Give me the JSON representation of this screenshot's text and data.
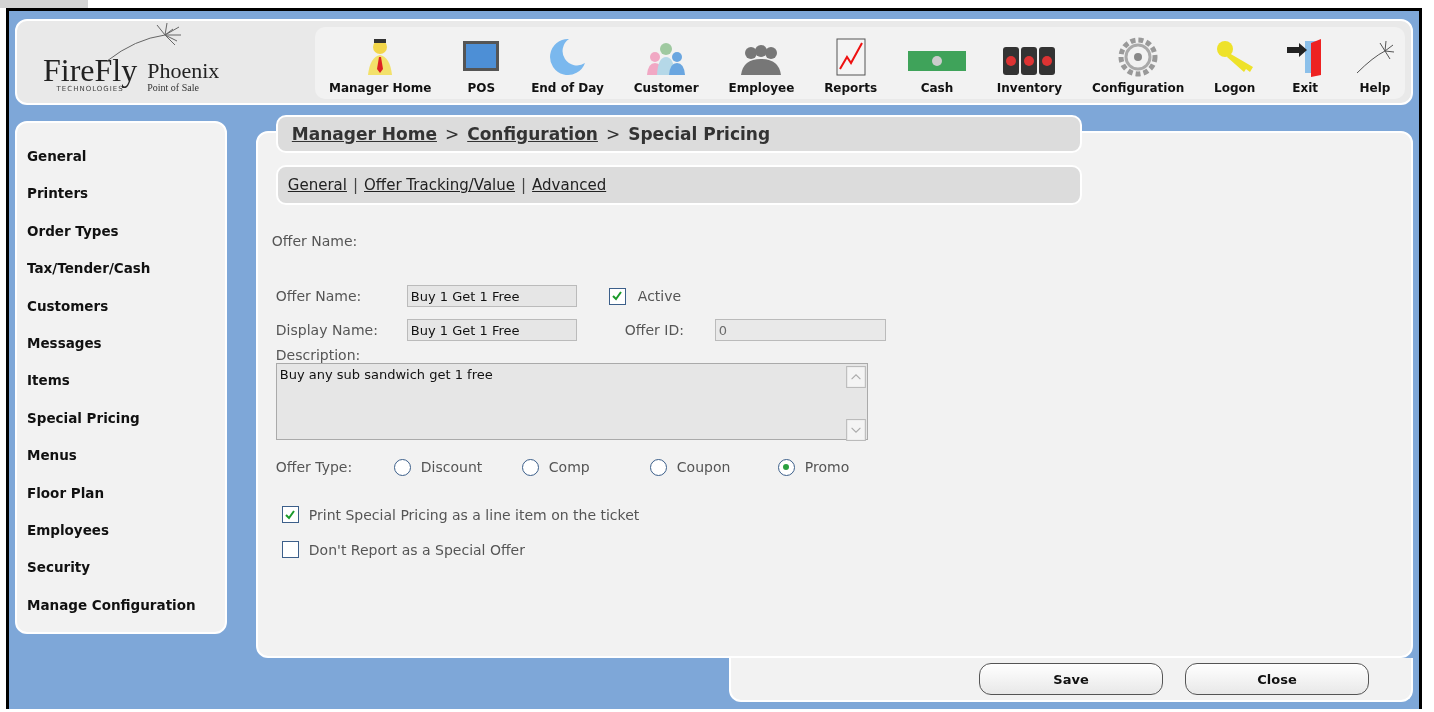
{
  "logo": {
    "brand": "FireFly",
    "brand_tagline": "TECHNOLOGIES",
    "product": "Phoenix",
    "product_tagline": "Point of Sale"
  },
  "toolbar": [
    {
      "label": "Manager Home",
      "kind": "manager"
    },
    {
      "label": "POS",
      "kind": "pos"
    },
    {
      "label": "End of Day",
      "kind": "endofday"
    },
    {
      "label": "Customer",
      "kind": "customer"
    },
    {
      "label": "Employee",
      "kind": "employee"
    },
    {
      "label": "Reports",
      "kind": "reports"
    },
    {
      "label": "Cash",
      "kind": "cash"
    },
    {
      "label": "Inventory",
      "kind": "inventory"
    },
    {
      "label": "Configuration",
      "kind": "configuration"
    },
    {
      "label": "Logon",
      "kind": "logon"
    },
    {
      "label": "Exit",
      "kind": "exit"
    },
    {
      "label": "Help",
      "kind": "help"
    }
  ],
  "sidebar": {
    "items": [
      "General",
      "Printers",
      "Order Types",
      "Tax/Tender/Cash",
      "Customers",
      "Messages",
      "Items",
      "Special Pricing",
      "Menus",
      "Floor Plan",
      "Employees",
      "Security",
      "Manage Configuration"
    ]
  },
  "breadcrumb": {
    "separator": ">",
    "items": [
      {
        "label": "Manager Home",
        "link": true
      },
      {
        "label": "Configuration",
        "link": true
      },
      {
        "label": "Special Pricing",
        "link": false
      }
    ]
  },
  "subnav": {
    "separator": "|",
    "items": [
      "General",
      "Offer Tracking/Value",
      "Advanced"
    ]
  },
  "form": {
    "heading": "Offer Name:",
    "offer_name": {
      "label": "Offer Name:",
      "value": "Buy 1 Get 1 Free"
    },
    "active": {
      "label": "Active",
      "checked": true
    },
    "display_name": {
      "label": "Display Name:",
      "value": "Buy 1 Get 1 Free"
    },
    "offer_id": {
      "label": "Offer ID:",
      "value": "0",
      "disabled": true
    },
    "description": {
      "label": "Description:",
      "value": "Buy any sub sandwich get 1 free"
    },
    "offer_type": {
      "label": "Offer Type:",
      "options": [
        {
          "label": "Discount",
          "selected": false
        },
        {
          "label": "Comp",
          "selected": false
        },
        {
          "label": "Coupon",
          "selected": false
        },
        {
          "label": "Promo",
          "selected": true
        }
      ]
    },
    "options": [
      {
        "label": "Print Special Pricing as a line item on the ticket",
        "checked": true
      },
      {
        "label": "Don't Report as a Special Offer",
        "checked": false
      }
    ]
  },
  "buttons": [
    "Save",
    "Close"
  ]
}
